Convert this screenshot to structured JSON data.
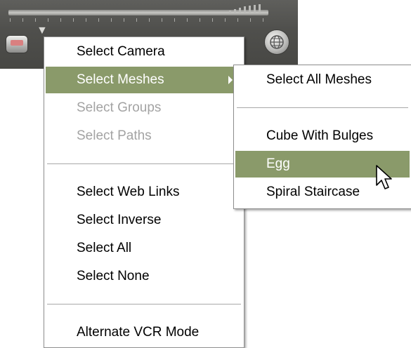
{
  "main_menu": {
    "items": [
      {
        "label": "Select Camera",
        "state": "enabled"
      },
      {
        "label": "Select Meshes",
        "state": "highlighted",
        "has_submenu": true
      },
      {
        "label": "Select Groups",
        "state": "disabled"
      },
      {
        "label": "Select Paths",
        "state": "disabled"
      },
      {
        "label": "Select Web Links",
        "state": "enabled"
      },
      {
        "label": "Select Inverse",
        "state": "enabled"
      },
      {
        "label": "Select All",
        "state": "enabled"
      },
      {
        "label": "Select None",
        "state": "enabled"
      },
      {
        "label": "Alternate VCR Mode",
        "state": "enabled"
      }
    ]
  },
  "sub_menu": {
    "items": [
      {
        "label": "Select All Meshes",
        "state": "enabled"
      },
      {
        "label": "Cube With Bulges",
        "state": "enabled"
      },
      {
        "label": "Egg",
        "state": "highlighted"
      },
      {
        "label": "Spiral Staircase",
        "state": "enabled"
      }
    ]
  },
  "colors": {
    "highlight": "#8a9a6a",
    "disabled_text": "#a3a3a3",
    "toolbar": "#4f4f4c"
  },
  "icons": [
    "funnel-icon",
    "globe-icon",
    "submenu-arrow-icon",
    "mouse-pointer-icon"
  ]
}
